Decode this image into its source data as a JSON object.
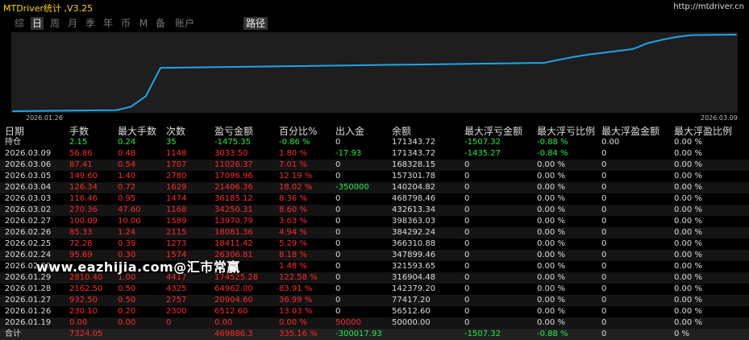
{
  "app": {
    "title": "MTDriver统计 ,V3.25",
    "url": "http://mtdriver.cn"
  },
  "tabs": [
    {
      "label": "综",
      "active": false
    },
    {
      "label": "日",
      "active": true
    },
    {
      "label": "周",
      "active": false
    },
    {
      "label": "月",
      "active": false
    },
    {
      "label": "季",
      "active": false
    },
    {
      "label": "年",
      "active": false
    },
    {
      "label": "币",
      "active": false
    },
    {
      "label": "M",
      "active": false
    },
    {
      "label": "备",
      "active": false
    },
    {
      "label": "账户",
      "active": false
    },
    {
      "label": "路径",
      "active": true
    }
  ],
  "chart_data": {
    "type": "line",
    "x": [
      "2026.01.19",
      "2026.01.26",
      "2026.01.27",
      "2026.01.28",
      "2026.01.29",
      "2026.02.02",
      "2026.02.24",
      "2026.02.25",
      "2026.02.26",
      "2026.02.27",
      "2026.03.02",
      "2026.03.03",
      "2026.03.04",
      "2026.03.05",
      "2026.03.06",
      "2026.03.09"
    ],
    "series": [
      {
        "values": [
          50000.0,
          56512.6,
          77417.2,
          142379.2,
          316904.48,
          321593.65,
          347899.46,
          366310.88,
          384292.24,
          398363.03,
          432613.34,
          468798.46,
          140204.82,
          157301.78,
          168328.15,
          171343.72
        ]
      }
    ],
    "x_tick_labels": [
      "2026.01.26",
      "2026.03.09"
    ],
    "color": "#1ea7e8",
    "background": "#1e1e1e"
  },
  "columns": [
    "日期",
    "手数",
    "最大手数",
    "次数",
    "盈亏金额",
    "百分比%",
    "出入金",
    "余额",
    "最大浮亏金额",
    "最大浮亏比例",
    "最大浮盈金额",
    "最大浮盈比例"
  ],
  "holding": {
    "label": "持仓",
    "cells": [
      "2.15",
      "0.24",
      "35",
      "-1475.35",
      "-0.86 %",
      "0",
      "171343.72",
      "-1507.32",
      "-0.88 %",
      "0.00",
      "0.00 %"
    ]
  },
  "rows": [
    {
      "date": "2026.03.09",
      "cells": [
        "56.86",
        "0.48",
        "1148",
        "3033.50",
        "1.80 %",
        "-17.93",
        "171343.72",
        "-1435.27",
        "-0.84 %",
        "0",
        "0.00 %"
      ]
    },
    {
      "date": "2026.03.06",
      "cells": [
        "87.41",
        "0.54",
        "1707",
        "11026.37",
        "7.01 %",
        "0",
        "168328.15",
        "0",
        "0.00 %",
        "0",
        "0.00 %"
      ]
    },
    {
      "date": "2026.03.05",
      "cells": [
        "149.60",
        "1.40",
        "2780",
        "17096.96",
        "12.19 %",
        "0",
        "157301.78",
        "0",
        "0.00 %",
        "0",
        "0.00 %"
      ]
    },
    {
      "date": "2026.03.04",
      "cells": [
        "126.34",
        "0.72",
        "1629",
        "21406.36",
        "18.02 %",
        "-350000",
        "140204.82",
        "0",
        "0.00 %",
        "0",
        "0.00 %"
      ]
    },
    {
      "date": "2026.03.03",
      "cells": [
        "116.46",
        "0.95",
        "1474",
        "36185.12",
        "8.36 %",
        "0",
        "468798.46",
        "0",
        "0.00 %",
        "0",
        "0.00 %"
      ]
    },
    {
      "date": "2026.03.02",
      "cells": [
        "270.36",
        "47.60",
        "1168",
        "34250.31",
        "8.60 %",
        "0",
        "432613.34",
        "0",
        "0.00 %",
        "0",
        "0.00 %"
      ]
    },
    {
      "date": "2026.02.27",
      "cells": [
        "100.09",
        "10.00",
        "1589",
        "13970.79",
        "3.63 %",
        "0",
        "398363.03",
        "0",
        "0.00 %",
        "0",
        "0.00 %"
      ]
    },
    {
      "date": "2026.02.26",
      "cells": [
        "85.33",
        "1.24",
        "2115",
        "18081.36",
        "4.94 %",
        "0",
        "384292.24",
        "0",
        "0.00 %",
        "0",
        "0.00 %"
      ]
    },
    {
      "date": "2026.02.25",
      "cells": [
        "72.28",
        "0.39",
        "1273",
        "18411.42",
        "5.29 %",
        "0",
        "366310.88",
        "0",
        "0.00 %",
        "0",
        "0.00 %"
      ]
    },
    {
      "date": "2026.02.24",
      "cells": [
        "95.69",
        "0.30",
        "1574",
        "26306.81",
        "8.18 %",
        "0",
        "347899.46",
        "0",
        "0.00 %",
        "0",
        "0.00 %"
      ]
    },
    {
      "date": "2026.02.02",
      "cells": [
        "",
        "",
        "",
        "",
        "1.48 %",
        "0",
        "321593.65",
        "0",
        "0.00 %",
        "0",
        "0.00 %"
      ]
    },
    {
      "date": "2026.01.29",
      "cells": [
        "2810.40",
        "1.00",
        "4417",
        "174525.28",
        "122.58 %",
        "0",
        "316904.48",
        "0",
        "0.00 %",
        "0",
        "0.00 %"
      ]
    },
    {
      "date": "2026.01.28",
      "cells": [
        "2162.50",
        "0.50",
        "4325",
        "64962.00",
        "83.91 %",
        "0",
        "142379.20",
        "0",
        "0.00 %",
        "0",
        "0.00 %"
      ]
    },
    {
      "date": "2026.01.27",
      "cells": [
        "932.50",
        "0.50",
        "2757",
        "20904.60",
        "36.99 %",
        "0",
        "77417.20",
        "0",
        "0.00 %",
        "0",
        "0.00 %"
      ]
    },
    {
      "date": "2026.01.26",
      "cells": [
        "230.10",
        "0.20",
        "2300",
        "6512.60",
        "13.03 %",
        "0",
        "56512.60",
        "0",
        "0.00 %",
        "0",
        "0.00 %"
      ]
    },
    {
      "date": "2026.01.19",
      "cells": [
        "0.00",
        "0.00",
        "0",
        "0.00",
        "0.00 %",
        "50000",
        "50000.00",
        "0",
        "0.00 %",
        "0",
        "0.00 %"
      ]
    }
  ],
  "total": {
    "label": "合计",
    "cells": [
      "7324.05",
      "",
      "",
      "469886.3",
      "335.16 %",
      "-300017.93",
      "",
      "-1507.32",
      "-0.88 %",
      "0",
      "0 %"
    ]
  },
  "watermark": "www.eazhijia.com@汇市常赢",
  "colors": {
    "positive": "#ff2a2a",
    "negative": "#22ee44",
    "neutral": "#dddddd",
    "accent": "#ffd700",
    "line": "#1ea7e8"
  }
}
